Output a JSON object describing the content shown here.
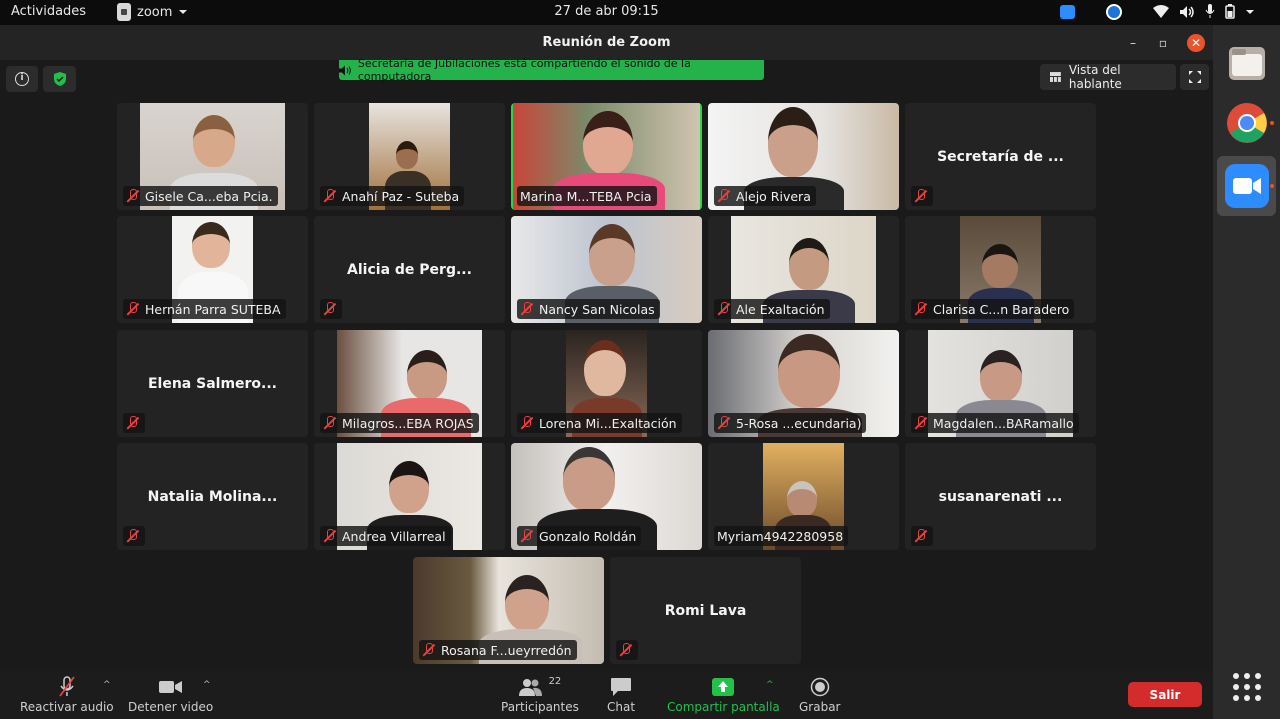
{
  "topbar": {
    "activities": "Actividades",
    "app_name": "zoom",
    "clock": "27 de abr  09:15"
  },
  "window": {
    "title": "Reunión de Zoom"
  },
  "meeting": {
    "share_banner": "Secretaría de Jubilaciones está compartiendo el sonido de la computadora",
    "view_mode": "Vista del hablante"
  },
  "participants": [
    {
      "name": "Gisele Ca...eba Pcia.",
      "video": true
    },
    {
      "name": "Anahí Paz - Suteba",
      "video": true
    },
    {
      "name": "Marina M...TEBA Pcia",
      "video": true,
      "active": true
    },
    {
      "name": "Alejo Rivera",
      "video": true
    },
    {
      "name": "Secretaría de ...",
      "video": false
    },
    {
      "name": "Hernán Parra SUTEBA",
      "video": true
    },
    {
      "name": "Alicia de Perg...",
      "video": false
    },
    {
      "name": "Nancy San Nicolas",
      "video": true
    },
    {
      "name": "Ale Exaltación",
      "video": true
    },
    {
      "name": "Clarisa C...n Baradero",
      "video": true
    },
    {
      "name": "Elena Salmero...",
      "video": false
    },
    {
      "name": "Milagros...EBA ROJAS",
      "video": true
    },
    {
      "name": "Lorena Mi...Exaltación",
      "video": true
    },
    {
      "name": "5-Rosa ...ecundaria)",
      "video": true
    },
    {
      "name": "Magdalen...BARamallo",
      "video": true
    },
    {
      "name": "Natalia Molina...",
      "video": false
    },
    {
      "name": "Andrea Villarreal",
      "video": true
    },
    {
      "name": "Gonzalo Roldán",
      "video": true
    },
    {
      "name": "Myriam4942280958",
      "video": true
    },
    {
      "name": "susanarenati ...",
      "video": false
    },
    {
      "name": "Rosana F...ueyrredón",
      "video": true
    },
    {
      "name": "Romi Lava",
      "video": false
    }
  ],
  "controls": {
    "unmute": "Reactivar audio",
    "stop_video": "Detener video",
    "participants": "Participantes",
    "participant_count": "22",
    "chat": "Chat",
    "share_screen": "Compartir pantalla",
    "record": "Grabar",
    "leave": "Salir"
  },
  "icons": {
    "zoom_tray": "zoom-tray-icon",
    "teamviewer_tray": "teamviewer-tray-icon",
    "wifi": "wifi-icon",
    "volume": "volume-icon",
    "mic": "microphone-icon",
    "battery": "battery-icon"
  },
  "colors": {
    "active_speaker": "#23d94a",
    "share_banner": "#24b24b",
    "leave_button": "#d42c2c",
    "muted": "#e94040"
  }
}
